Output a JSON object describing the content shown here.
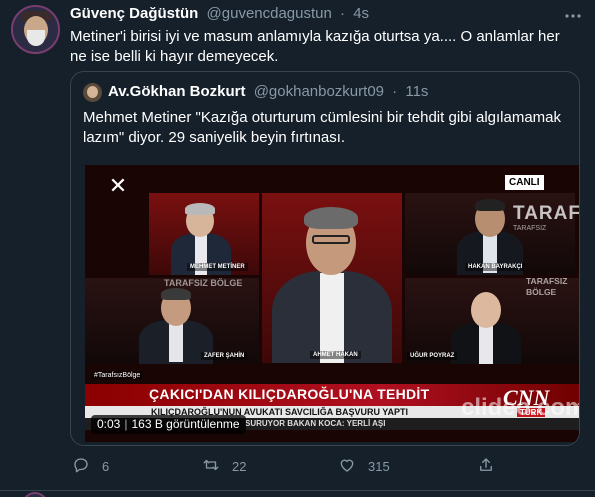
{
  "tweet": {
    "author_name": "Güvenç Dağüstün",
    "author_handle": "@guvencdagustun",
    "separator": "·",
    "time": "4s",
    "text": "Metiner'i birisi iyi ve masum anlamıyla kazığa oturtsa ya.... O anlamlar her ne ise belli ki hayır demeyecek.",
    "more_icon": "ellipsis-icon"
  },
  "quoted": {
    "author_name": "Av.Gökhan Bozkurt",
    "author_handle": "@gokhanbozkurt09",
    "separator": "·",
    "time": "11s",
    "text": "Mehmet Metiner \"Kazığa oturturum cümlesini bir tehdit gibi algılamamak lazım\" diyor. 29 saniyelik beyin fırtınası."
  },
  "video": {
    "close_icon": "close-icon",
    "live_label": "CANLI",
    "channel_logo": "CNN",
    "channel_sub": "TÜRK",
    "program_logo": "TARAF",
    "program_sub": "TARAFSIZ",
    "program_logo_2": "TARAFSIZ BÖLGE",
    "program_logo_left": "TARAFSIZ BÖLGE",
    "hashtag": "#TarafsızBölge",
    "headline": "ÇAKICI'DAN KILIÇDAROĞLU'NA TEHDİT",
    "subhead": "KILIÇDAROĞLU'NUN AVUKATI SAVCILIĞA BAŞVURU YAPTI",
    "ticker": "SURUYOR   BAKAN KOCA: YERLİ AŞI",
    "watermark": "clideo.com",
    "duration": "0:03",
    "views": "163 B görüntülenme",
    "guests": [
      {
        "name": "MEHMET METİNER"
      },
      {
        "name": "HAKAN BAYRAKÇI"
      },
      {
        "name": "ZAFER ŞAHİN"
      },
      {
        "name": "AHMET HAKAN"
      },
      {
        "name": "UĞUR POYRAZ"
      }
    ]
  },
  "actions": {
    "reply_count": "6",
    "retweet_count": "22",
    "like_count": "315",
    "reply_icon": "reply-icon",
    "retweet_icon": "retweet-icon",
    "like_icon": "heart-icon",
    "share_icon": "share-icon"
  },
  "colors": {
    "background": "#15202b",
    "secondary_text": "#8899a6",
    "border": "#38444d"
  }
}
